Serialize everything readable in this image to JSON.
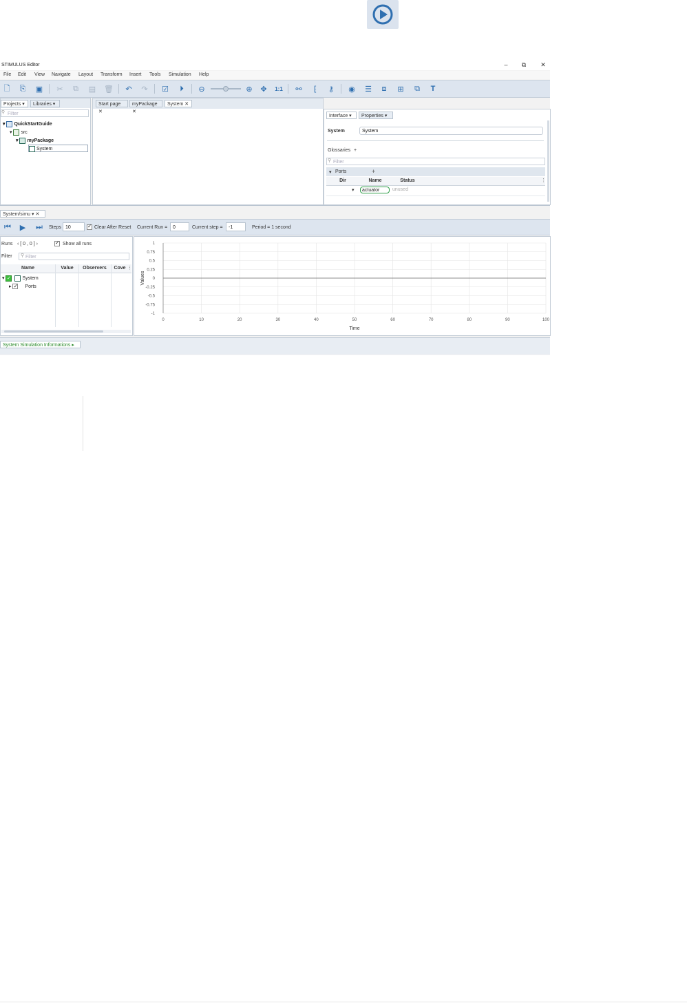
{
  "titlebar": {
    "title": "STIMULUS Editor",
    "min": "–",
    "max": "⧉",
    "close": "✕"
  },
  "menu": [
    "File",
    "Edit",
    "View",
    "Navigate",
    "Layout",
    "Transform",
    "Insert",
    "Tools",
    "Simulation",
    "Help"
  ],
  "toolbar": {
    "zoom_reset": "1:1"
  },
  "left_panel": {
    "tabs": [
      "Projects ▾",
      "Libraries ▾"
    ],
    "filter_placeholder": "Filter",
    "tree": [
      {
        "label": "QuickStartGuide",
        "level": 0
      },
      {
        "label": "src",
        "level": 1
      },
      {
        "label": "myPackage",
        "level": 2
      },
      {
        "label": "System",
        "level": 3
      }
    ]
  },
  "editor_tabs": [
    "Start page ✕",
    "myPackage ✕",
    "System ✕"
  ],
  "right_panel": {
    "tabs": [
      "Interface ▾",
      "Properties ▾"
    ],
    "system_label": "System",
    "system_value": "System",
    "glossaries_label": "Glossaries",
    "glossaries_add": "+",
    "filter_placeholder": "Filter",
    "ports_label": "Ports",
    "ports_add": "+",
    "columns": [
      "Dir",
      "Name",
      "Status"
    ],
    "row": {
      "dir": "▾",
      "name": "actuator",
      "status": "unused"
    }
  },
  "sim": {
    "tab_label": "System/simu ▾ ✕",
    "steps_label": "Steps",
    "steps_value": "10",
    "clear_after_reset": "Clear After Reset",
    "current_run_label": "Current Run =",
    "current_run_value": "0",
    "current_step_label": "Current step =",
    "current_step_value": "-1",
    "period": "Period = 1 second",
    "runs_label": "Runs",
    "runs_range": "‹ [ 0 , 0 ] ›",
    "show_all_runs": "Show all runs",
    "filter_label": "Filter",
    "filter_placeholder": "Filter",
    "columns": [
      "Name",
      "Value",
      "Observers",
      "Cove"
    ],
    "tree": [
      {
        "label": "System"
      },
      {
        "label": "Ports"
      }
    ]
  },
  "chart_data": {
    "type": "line",
    "xlabel": "Time",
    "ylabel": "Values",
    "xlim": [
      0,
      100
    ],
    "ylim": [
      -1,
      1
    ],
    "xticks": [
      "0",
      "10",
      "20",
      "30",
      "40",
      "50",
      "60",
      "70",
      "80",
      "90",
      "100"
    ],
    "yticks": [
      "1",
      "0.75",
      "0.5",
      "0.25",
      "0",
      "-0.25",
      "-0.5",
      "-0.75",
      "-1"
    ],
    "series": [],
    "grid": true
  },
  "bottom": {
    "info_tab": "System Simulation Informations ▸"
  }
}
